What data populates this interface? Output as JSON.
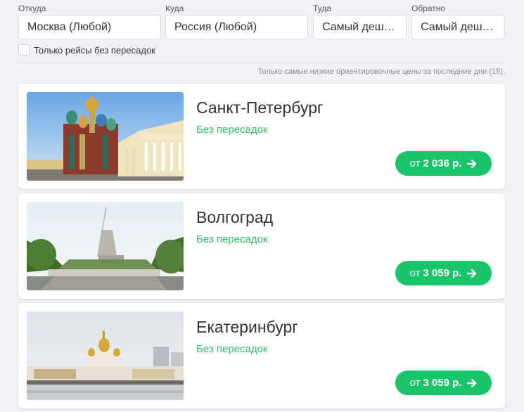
{
  "search": {
    "from_label": "Откуда",
    "from_value": "Москва (Любой)",
    "to_label": "Куда",
    "to_value": "Россия (Любой)",
    "depart_label": "Туда",
    "depart_value": "Самый дешевый",
    "return_label": "Обратно",
    "return_value": "Самый дешевый",
    "direct_only_label": "Только рейсы без пересадок"
  },
  "note": "Только самые низкие ориентировочные цены за последние дни (15).",
  "cards": [
    {
      "city": "Санкт-Петербург",
      "transfer": "Без пересадок",
      "price_prefix": "от",
      "price": "2 036 р.",
      "photo_icon": "saint-petersburg-photo"
    },
    {
      "city": "Волгоград",
      "transfer": "Без пересадок",
      "price_prefix": "от",
      "price": "3 059 р.",
      "photo_icon": "volgograd-photo"
    },
    {
      "city": "Екатеринбург",
      "transfer": "Без пересадок",
      "price_prefix": "от",
      "price": "3 059 р.",
      "photo_icon": "yekaterinburg-photo"
    }
  ],
  "colors": {
    "accent": "#1ac46a",
    "direct_text": "#2ec36b",
    "background": "#f1f2f5"
  }
}
